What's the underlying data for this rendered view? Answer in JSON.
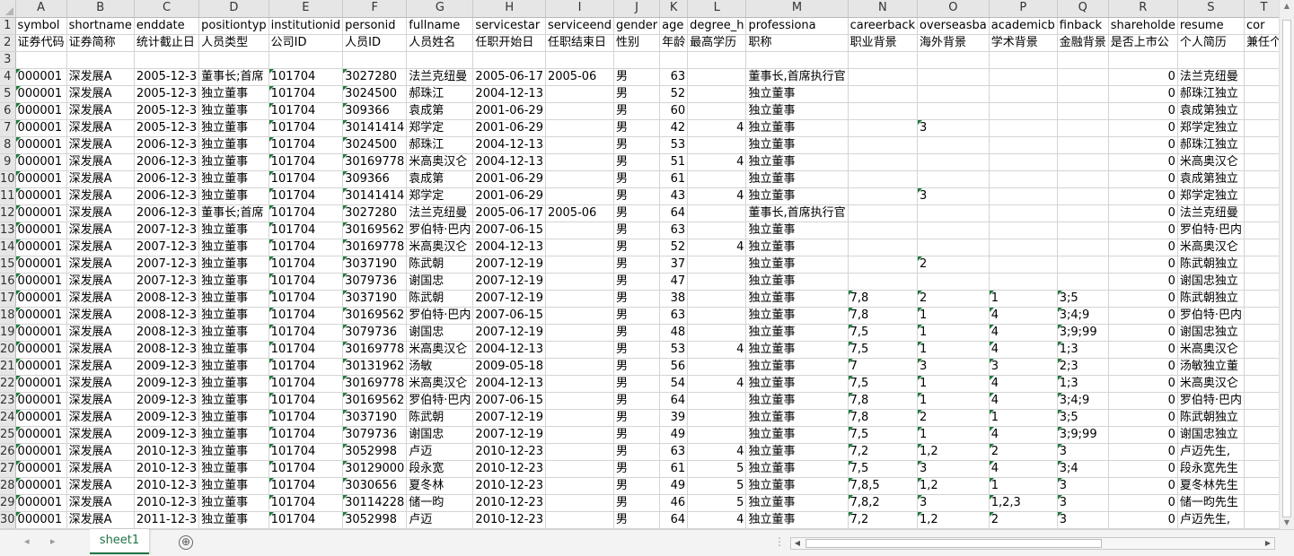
{
  "columns": [
    "A",
    "B",
    "C",
    "D",
    "E",
    "F",
    "G",
    "H",
    "I",
    "J",
    "K",
    "L",
    "M",
    "N",
    "O",
    "P",
    "Q",
    "R",
    "S",
    "T"
  ],
  "row_numbers": [
    1,
    2,
    3,
    4,
    5,
    6,
    7,
    8,
    9,
    10,
    11,
    12,
    13,
    14,
    15,
    16,
    17,
    18,
    19,
    20,
    21,
    22,
    23,
    24,
    25,
    26,
    27,
    28,
    29,
    30
  ],
  "header_row1": [
    "symbol",
    "shortname",
    "enddate",
    "positiontyp",
    "institutionid",
    "personid",
    "fullname",
    "servicestar",
    "serviceend",
    "gender",
    "age",
    "degree_h",
    "professiona",
    "careerback",
    "overseasba",
    "academicb",
    "finback",
    "shareholde",
    "resume",
    "cor"
  ],
  "header_row2": [
    "证券代码",
    "证券简称",
    "统计截止日",
    "人员类型",
    "公司ID",
    "人员ID",
    "人员姓名",
    "任职开始日",
    "任职结束日",
    "性别",
    "年龄",
    "最高学历",
    "职称",
    "职业背景",
    "海外背景",
    "学术背景",
    "金融背景",
    "是否上市公",
    "个人简历",
    "兼任个"
  ],
  "row3": [
    "",
    "",
    "",
    "",
    "",
    "",
    "",
    "",
    "",
    "",
    "",
    "",
    "",
    "",
    "",
    "",
    "",
    "",
    "",
    ""
  ],
  "data_rows": [
    [
      "000001",
      "深发展A",
      "2005-12-3",
      "董事长;首席",
      "101704",
      "3027280",
      "法兰克纽曼",
      "2005-06-17",
      "2005-06",
      "男",
      "63",
      "",
      "董事长,首席执行官",
      "",
      "",
      "",
      "",
      "0",
      "法兰克纽曼",
      ""
    ],
    [
      "000001",
      "深发展A",
      "2005-12-3",
      "独立董事",
      "101704",
      "3024500",
      "郝珠江",
      "2004-12-13",
      "",
      "男",
      "52",
      "",
      "独立董事",
      "",
      "",
      "",
      "",
      "0",
      "郝珠江独立",
      ""
    ],
    [
      "000001",
      "深发展A",
      "2005-12-3",
      "独立董事",
      "101704",
      "309366",
      "袁成第",
      "2001-06-29",
      "",
      "男",
      "60",
      "",
      "独立董事",
      "",
      "",
      "",
      "",
      "0",
      "袁成第独立",
      ""
    ],
    [
      "000001",
      "深发展A",
      "2005-12-3",
      "独立董事",
      "101704",
      "30141414",
      "郑学定",
      "2001-06-29",
      "",
      "男",
      "42",
      "4",
      "独立董事",
      "",
      "3",
      "",
      "",
      "0",
      "郑学定独立",
      ""
    ],
    [
      "000001",
      "深发展A",
      "2006-12-3",
      "独立董事",
      "101704",
      "3024500",
      "郝珠江",
      "2004-12-13",
      "",
      "男",
      "53",
      "",
      "独立董事",
      "",
      "",
      "",
      "",
      "0",
      "郝珠江独立",
      ""
    ],
    [
      "000001",
      "深发展A",
      "2006-12-3",
      "独立董事",
      "101704",
      "30169778",
      "米高奥汉仑",
      "2004-12-13",
      "",
      "男",
      "51",
      "4",
      "独立董事",
      "",
      "",
      "",
      "",
      "0",
      "米高奥汉仑",
      ""
    ],
    [
      "000001",
      "深发展A",
      "2006-12-3",
      "独立董事",
      "101704",
      "309366",
      "袁成第",
      "2001-06-29",
      "",
      "男",
      "61",
      "",
      "独立董事",
      "",
      "",
      "",
      "",
      "0",
      "袁成第独立",
      ""
    ],
    [
      "000001",
      "深发展A",
      "2006-12-3",
      "独立董事",
      "101704",
      "30141414",
      "郑学定",
      "2001-06-29",
      "",
      "男",
      "43",
      "4",
      "独立董事",
      "",
      "3",
      "",
      "",
      "0",
      "郑学定独立",
      ""
    ],
    [
      "000001",
      "深发展A",
      "2006-12-3",
      "董事长;首席",
      "101704",
      "3027280",
      "法兰克纽曼",
      "2005-06-17",
      "2005-06",
      "男",
      "64",
      "",
      "董事长,首席执行官",
      "",
      "",
      "",
      "",
      "0",
      "法兰克纽曼",
      ""
    ],
    [
      "000001",
      "深发展A",
      "2007-12-3",
      "独立董事",
      "101704",
      "30169562",
      "罗伯特·巴内",
      "2007-06-15",
      "",
      "男",
      "63",
      "",
      "独立董事",
      "",
      "",
      "",
      "",
      "0",
      "罗伯特·巴内",
      ""
    ],
    [
      "000001",
      "深发展A",
      "2007-12-3",
      "独立董事",
      "101704",
      "30169778",
      "米高奥汉仑",
      "2004-12-13",
      "",
      "男",
      "52",
      "4",
      "独立董事",
      "",
      "",
      "",
      "",
      "0",
      "米高奥汉仑",
      ""
    ],
    [
      "000001",
      "深发展A",
      "2007-12-3",
      "独立董事",
      "101704",
      "3037190",
      "陈武朝",
      "2007-12-19",
      "",
      "男",
      "37",
      "",
      "独立董事",
      "",
      "2",
      "",
      "",
      "0",
      "陈武朝独立",
      ""
    ],
    [
      "000001",
      "深发展A",
      "2007-12-3",
      "独立董事",
      "101704",
      "3079736",
      "谢国忠",
      "2007-12-19",
      "",
      "男",
      "47",
      "",
      "独立董事",
      "",
      "",
      "",
      "",
      "0",
      "谢国忠独立",
      ""
    ],
    [
      "000001",
      "深发展A",
      "2008-12-3",
      "独立董事",
      "101704",
      "3037190",
      "陈武朝",
      "2007-12-19",
      "",
      "男",
      "38",
      "",
      "独立董事",
      "7,8",
      "2",
      "1",
      "3;5",
      "0",
      "陈武朝独立",
      ""
    ],
    [
      "000001",
      "深发展A",
      "2008-12-3",
      "独立董事",
      "101704",
      "30169562",
      "罗伯特·巴内",
      "2007-06-15",
      "",
      "男",
      "63",
      "",
      "独立董事",
      "7,8",
      "1",
      "4",
      "3;4;9",
      "0",
      "罗伯特·巴内",
      ""
    ],
    [
      "000001",
      "深发展A",
      "2008-12-3",
      "独立董事",
      "101704",
      "3079736",
      "谢国忠",
      "2007-12-19",
      "",
      "男",
      "48",
      "",
      "独立董事",
      "7,5",
      "1",
      "4",
      "3;9;99",
      "0",
      "谢国忠独立",
      ""
    ],
    [
      "000001",
      "深发展A",
      "2008-12-3",
      "独立董事",
      "101704",
      "30169778",
      "米高奥汉仑",
      "2004-12-13",
      "",
      "男",
      "53",
      "4",
      "独立董事",
      "7,5",
      "1",
      "4",
      "1;3",
      "0",
      "米高奥汉仑",
      ""
    ],
    [
      "000001",
      "深发展A",
      "2009-12-3",
      "独立董事",
      "101704",
      "30131962",
      "汤敏",
      "2009-05-18",
      "",
      "男",
      "56",
      "",
      "独立董事",
      "7",
      "3",
      "3",
      "2;3",
      "0",
      "汤敏独立董",
      ""
    ],
    [
      "000001",
      "深发展A",
      "2009-12-3",
      "独立董事",
      "101704",
      "30169778",
      "米高奥汉仑",
      "2004-12-13",
      "",
      "男",
      "54",
      "4",
      "独立董事",
      "7,5",
      "1",
      "4",
      "1;3",
      "0",
      "米高奥汉仑",
      ""
    ],
    [
      "000001",
      "深发展A",
      "2009-12-3",
      "独立董事",
      "101704",
      "30169562",
      "罗伯特·巴内",
      "2007-06-15",
      "",
      "男",
      "64",
      "",
      "独立董事",
      "7,8",
      "1",
      "4",
      "3;4;9",
      "0",
      "罗伯特·巴内",
      ""
    ],
    [
      "000001",
      "深发展A",
      "2009-12-3",
      "独立董事",
      "101704",
      "3037190",
      "陈武朝",
      "2007-12-19",
      "",
      "男",
      "39",
      "",
      "独立董事",
      "7,8",
      "2",
      "1",
      "3;5",
      "0",
      "陈武朝独立",
      ""
    ],
    [
      "000001",
      "深发展A",
      "2009-12-3",
      "独立董事",
      "101704",
      "3079736",
      "谢国忠",
      "2007-12-19",
      "",
      "男",
      "49",
      "",
      "独立董事",
      "7,5",
      "1",
      "4",
      "3;9;99",
      "0",
      "谢国忠独立",
      ""
    ],
    [
      "000001",
      "深发展A",
      "2010-12-3",
      "独立董事",
      "101704",
      "3052998",
      "卢迈",
      "2010-12-23",
      "",
      "男",
      "63",
      "4",
      "独立董事",
      "7,2",
      "1,2",
      "2",
      "3",
      "0",
      "卢迈先生,",
      ""
    ],
    [
      "000001",
      "深发展A",
      "2010-12-3",
      "独立董事",
      "101704",
      "30129000",
      "段永宽",
      "2010-12-23",
      "",
      "男",
      "61",
      "5",
      "独立董事",
      "7,5",
      "3",
      "4",
      "3;4",
      "0",
      "段永宽先生",
      ""
    ],
    [
      "000001",
      "深发展A",
      "2010-12-3",
      "独立董事",
      "101704",
      "3030656",
      "夏冬林",
      "2010-12-23",
      "",
      "男",
      "49",
      "5",
      "独立董事",
      "7,8,5",
      "1,2",
      "1",
      "3",
      "0",
      "夏冬林先生",
      ""
    ],
    [
      "000001",
      "深发展A",
      "2010-12-3",
      "独立董事",
      "101704",
      "30114228",
      "储一昀",
      "2010-12-23",
      "",
      "男",
      "46",
      "5",
      "独立董事",
      "7,8,2",
      "3",
      "1,2,3",
      "3",
      "0",
      "储一昀先生",
      ""
    ],
    [
      "000001",
      "深发展A",
      "2011-12-3",
      "独立董事",
      "101704",
      "3052998",
      "卢迈",
      "2010-12-23",
      "",
      "男",
      "64",
      "4",
      "独立董事",
      "7,2",
      "1,2",
      "2",
      "3",
      "0",
      "卢迈先生,",
      ""
    ]
  ],
  "sheet_tab": "sheet1",
  "add_sheet_symbol": "⊕",
  "split_symbol": "⋮",
  "colors": {
    "accent": "#217346",
    "header_bg": "#e6e6e6",
    "gridline": "#d4d4d4",
    "comment_marker": "#1e7b3c"
  }
}
